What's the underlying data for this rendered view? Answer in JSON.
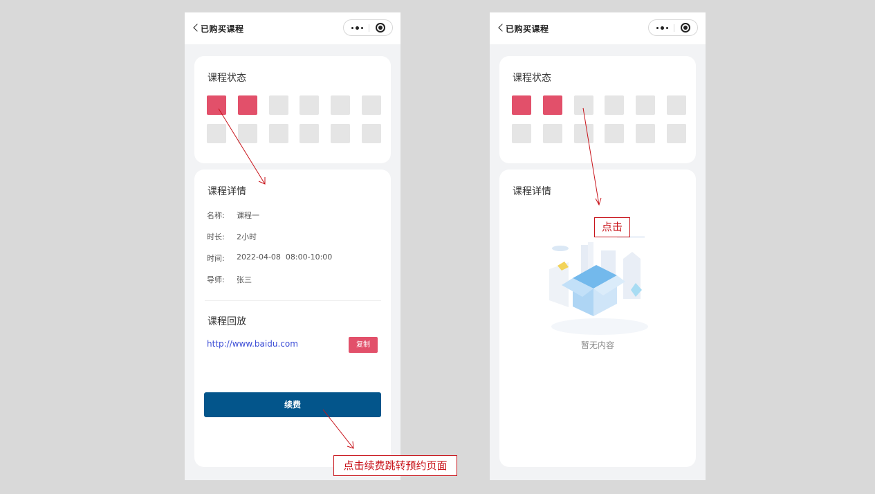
{
  "left_screen": {
    "nav": {
      "title": "已购买课程"
    },
    "status_card": {
      "title": "课程状态",
      "cells": [
        1,
        1,
        0,
        0,
        0,
        0,
        0,
        0,
        0,
        0,
        0,
        0
      ]
    },
    "detail_card": {
      "title": "课程详情",
      "rows": [
        {
          "key": "名称:",
          "value": "课程一"
        },
        {
          "key": "时长:",
          "value": "2小时"
        },
        {
          "key": "时间:",
          "value": "2022-04-08  08:00-10:00"
        },
        {
          "key": "导师:",
          "value": "张三"
        }
      ],
      "replay_title": "课程回放",
      "replay_link": "http://www.baidu.com",
      "copy_label": "复制",
      "renew_label": "续费"
    }
  },
  "right_screen": {
    "nav": {
      "title": "已购买课程"
    },
    "status_card": {
      "title": "课程状态",
      "cells": [
        1,
        1,
        0,
        0,
        0,
        0,
        0,
        0,
        0,
        0,
        0,
        0
      ]
    },
    "detail_card": {
      "title": "课程详情",
      "empty_text": "暂无内容"
    }
  },
  "annotations": {
    "left": "点击续费跳转预约页面",
    "right": "点击"
  },
  "colors": {
    "active_cell": "#e2506a",
    "inactive_cell": "#e5e5e5",
    "renew_button": "#03558b",
    "link": "#3b4cd6",
    "annotation": "#c8141b",
    "page_bg": "#d9d9d9",
    "phone_bg": "#f2f3f5"
  }
}
